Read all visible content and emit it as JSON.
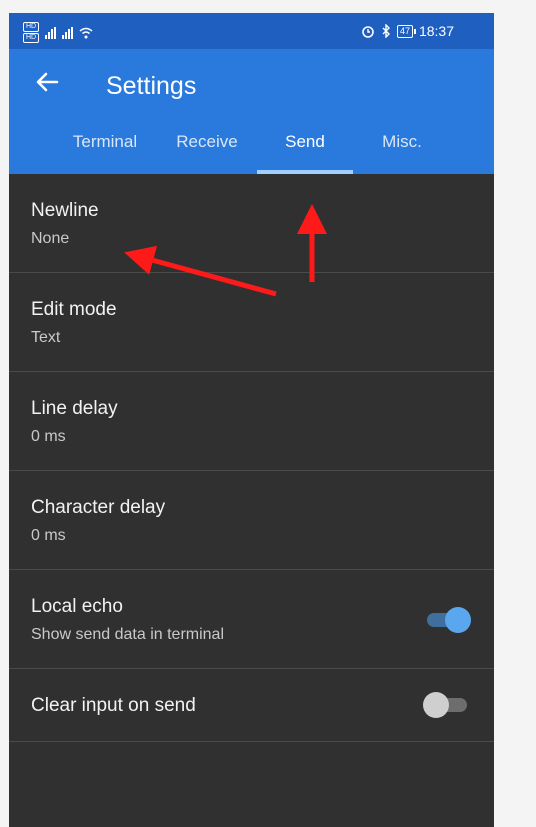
{
  "status": {
    "sim1": "HD",
    "sim2": "HD",
    "time": "18:37",
    "battery": "47"
  },
  "appbar": {
    "title": "Settings"
  },
  "tabs": [
    {
      "label": "Terminal",
      "active": false
    },
    {
      "label": "Receive",
      "active": false
    },
    {
      "label": "Send",
      "active": true
    },
    {
      "label": "Misc.",
      "active": false
    }
  ],
  "settings": [
    {
      "label": "Newline",
      "value": "None"
    },
    {
      "label": "Edit mode",
      "value": "Text"
    },
    {
      "label": "Line delay",
      "value": "0 ms"
    },
    {
      "label": "Character delay",
      "value": "0 ms"
    },
    {
      "label": "Local echo",
      "value": "Show send data in terminal",
      "toggle": true
    },
    {
      "label": "Clear input on send",
      "toggle": false
    }
  ],
  "colors": {
    "appbar": "#2a79dc",
    "statusbar": "#1f5fbf",
    "background": "#303030",
    "annotation": "#ff1a1a"
  }
}
